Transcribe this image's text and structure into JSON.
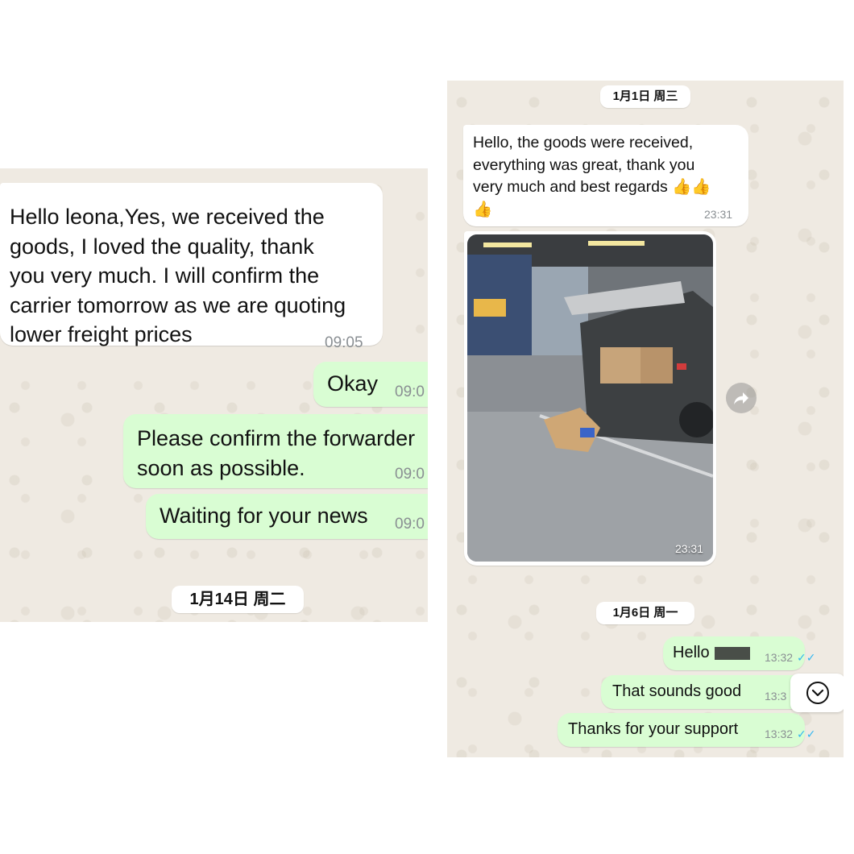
{
  "left_chat": {
    "messages": [
      {
        "direction": "incoming",
        "text": "Hello leona,Yes, we received the\ngoods, I loved the quality, thank\nyou very much. I will confirm the\ncarrier tomorrow as we are quoting\nlower freight prices",
        "time": "09:05"
      },
      {
        "direction": "outgoing",
        "text": "Okay",
        "time": "09:0"
      },
      {
        "direction": "outgoing",
        "text": "Please confirm the forwarder\nsoon as possible.",
        "time": "09:0"
      },
      {
        "direction": "outgoing",
        "text": "Waiting for your news",
        "time": "09:0"
      }
    ],
    "date_separator": "1月14日 周二"
  },
  "right_chat": {
    "date_separator_1": "1月1日 周三",
    "messages": [
      {
        "direction": "incoming",
        "text": "Hello, the goods were received,\neverything was great, thank you\nvery much and best regards 👍👍\n👍",
        "time": "23:31"
      }
    ],
    "photo": {
      "time": "23:31"
    },
    "date_separator_2": "1月6日 周一",
    "outgoing": [
      {
        "text": "Hello",
        "time": "13:32"
      },
      {
        "text": "That sounds good",
        "time": "13:3"
      },
      {
        "text": "Thanks for your support",
        "time": "13:32"
      }
    ]
  },
  "icons": [
    "forward-icon",
    "double-check-icon",
    "chevron-down-icon"
  ],
  "colors": {
    "incoming_bubble": "#ffffff",
    "outgoing_bubble": "#d9fdd3",
    "chat_background": "#efeae2",
    "read_ticks": "#34b7f1"
  }
}
